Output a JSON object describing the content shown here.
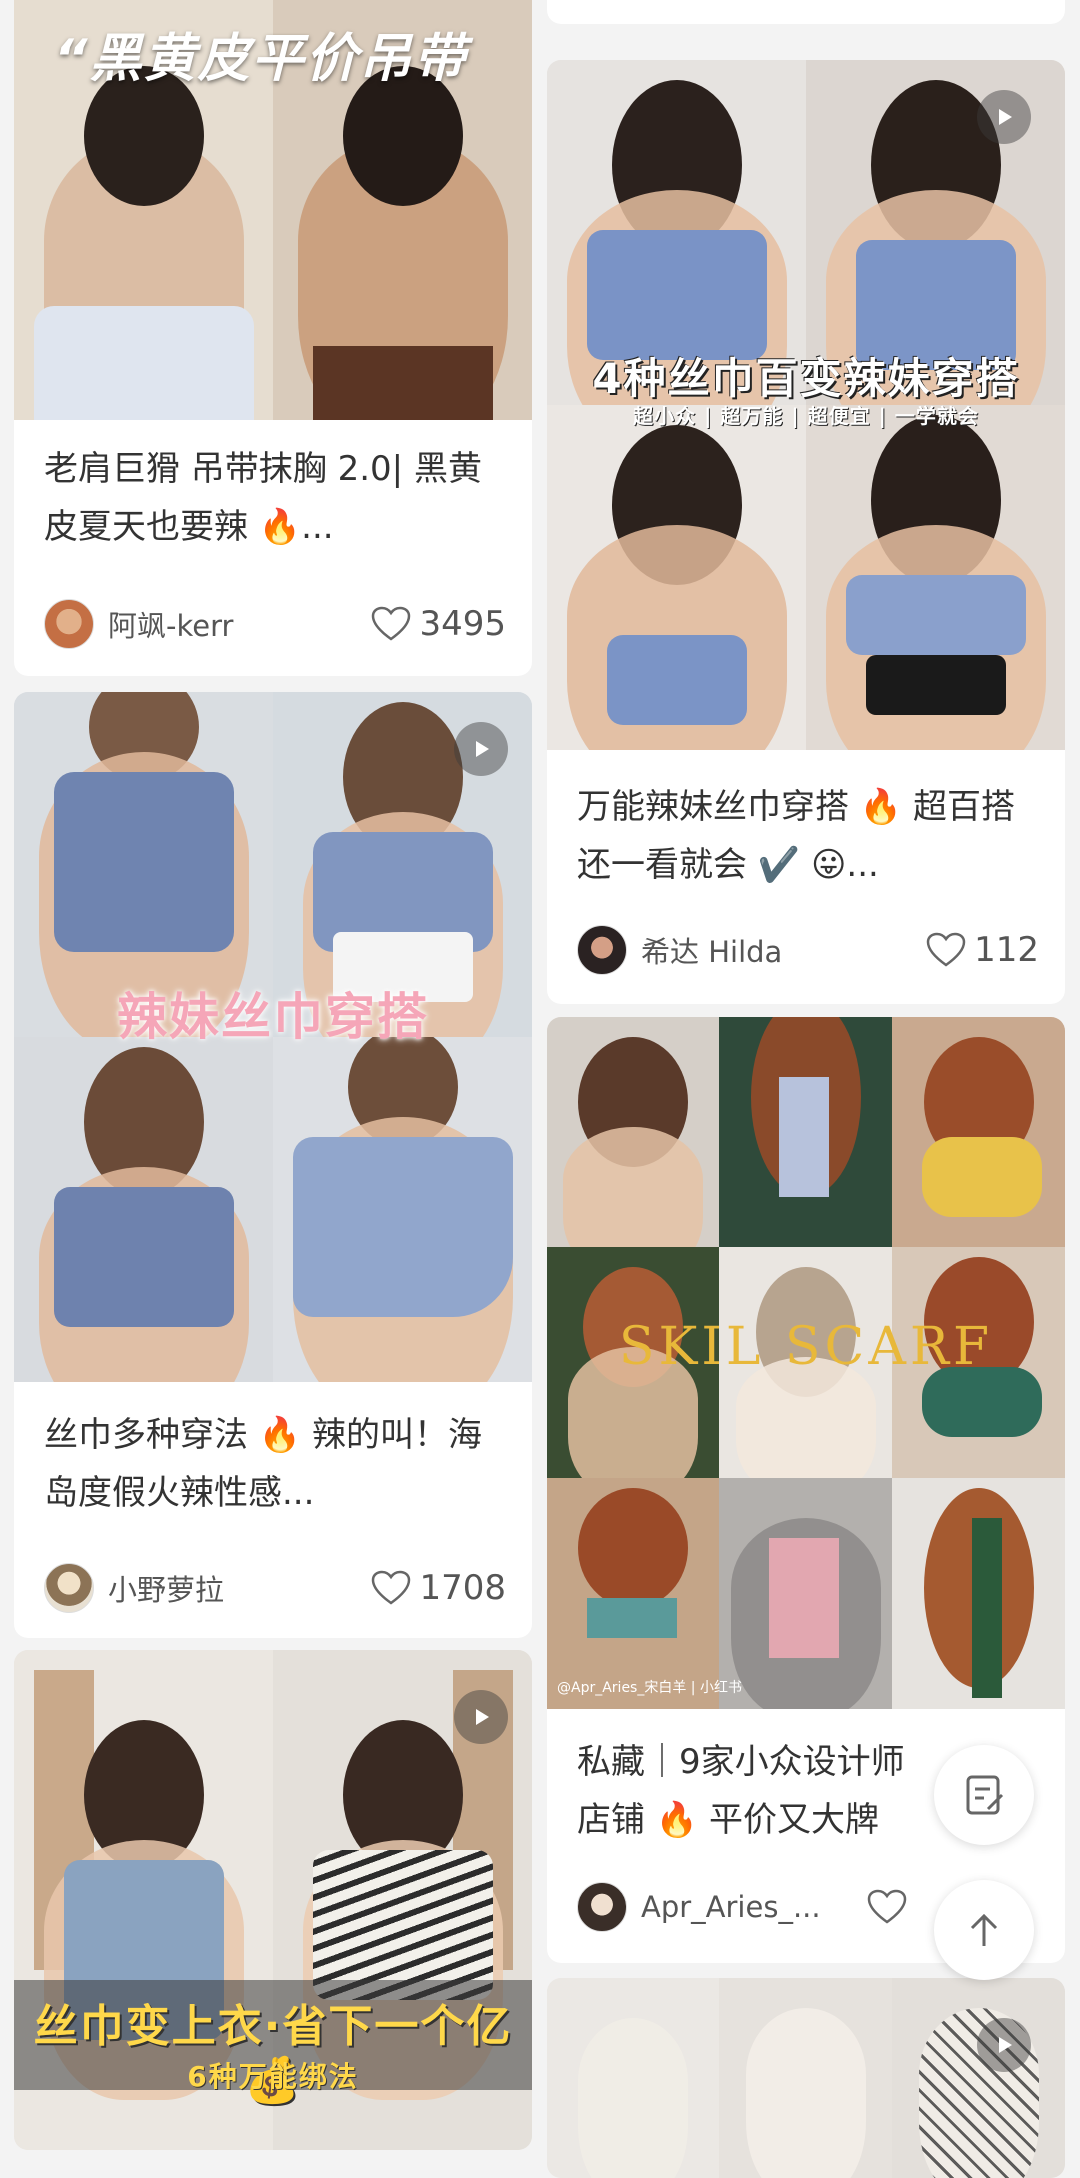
{
  "feed": {
    "left": [
      {
        "cover_text": "“黑黄皮平价吊带",
        "title": "老肩巨猾 吊带抹胸 2.0| 黑黄皮夏天也要辣 🔥...",
        "author": "阿飒-kerr",
        "likes": "3495",
        "has_video": false
      },
      {
        "cover_text": "辣妹丝巾穿搭",
        "title": "丝巾多种穿法 🔥 辣的叫！海岛度假火辣性感...",
        "author": "小野萝拉",
        "likes": "1708",
        "has_video": true
      },
      {
        "cover_text": "丝巾变上衣·省下一个亿💰",
        "cover_subtext": "6种万能绑法",
        "has_video": true
      }
    ],
    "right": [
      {
        "cover_text": "4种丝巾百变辣妹穿搭",
        "cover_subtext": "超小众 | 超万能 | 超便宜 | 一学就会",
        "title": "万能辣妹丝巾穿搭 🔥 超百搭还一看就会 ✔️ 😛...",
        "author": "希达 Hilda",
        "likes": "112",
        "has_video": true
      },
      {
        "cover_text": "SKIL SCARF",
        "watermark": "@Apr_Aries_宋白羊 | 小红书",
        "title": "私藏｜9家小众设计师店铺 🔥 平价又大牌",
        "author": "Apr_Aries_...",
        "likes": "",
        "has_video": false
      },
      {
        "has_video": true
      }
    ]
  },
  "icons": {
    "like": "heart-outline-icon",
    "play": "play-icon",
    "compose": "compose-icon",
    "top": "arrow-up-icon"
  },
  "colors": {
    "background": "#f3f3f3",
    "card": "#ffffff",
    "text": "#333333",
    "meta": "#555555"
  }
}
